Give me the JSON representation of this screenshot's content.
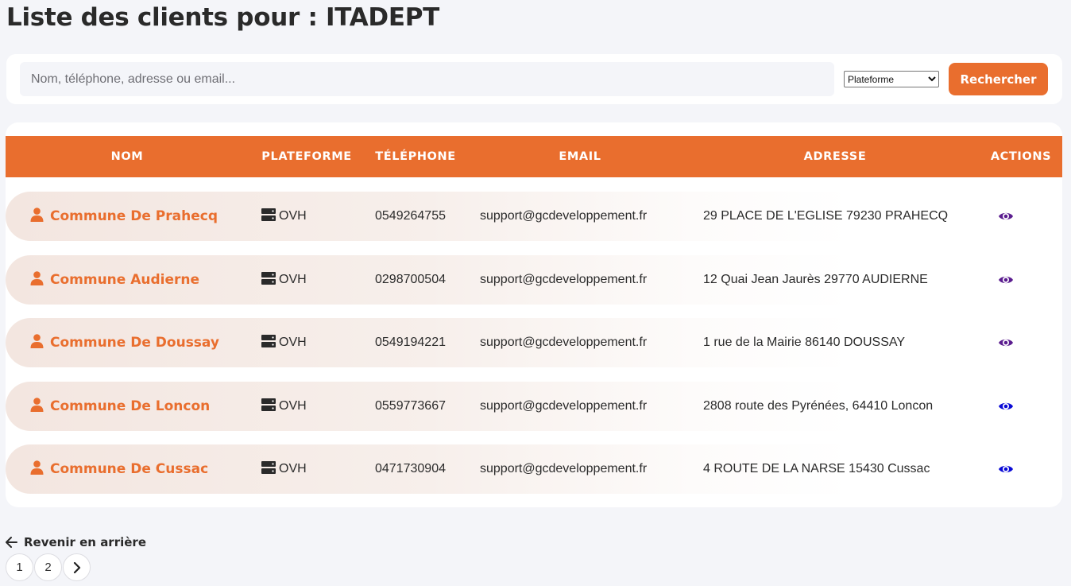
{
  "page": {
    "title": "Liste des clients pour : ITADEPT"
  },
  "search": {
    "placeholder": "Nom, téléphone, adresse ou email...",
    "value": "",
    "platform_selected": "Plateforme",
    "button_label": "Rechercher"
  },
  "table": {
    "headers": {
      "nom": "NOM",
      "plateforme": "PLATEFORME",
      "telephone": "TÉLÉPHONE",
      "email": "EMAIL",
      "adresse": "ADRESSE",
      "actions": "ACTIONS"
    },
    "rows": [
      {
        "name": "Commune De Prahecq",
        "platform": "OVH",
        "phone": "0549264755",
        "email": "support@gcdeveloppement.fr",
        "address": "29 PLACE DE L'EGLISE 79230 PRAHECQ",
        "eye_color": "#5b1d8f"
      },
      {
        "name": "Commune Audierne",
        "platform": "OVH",
        "phone": "0298700504",
        "email": "support@gcdeveloppement.fr",
        "address": "12 Quai Jean Jaurès 29770 AUDIERNE",
        "eye_color": "#5b1d8f"
      },
      {
        "name": "Commune De Doussay",
        "platform": "OVH",
        "phone": "0549194221",
        "email": "support@gcdeveloppement.fr",
        "address": "1 rue de la Mairie 86140 DOUSSAY",
        "eye_color": "#5b1d8f"
      },
      {
        "name": "Commune De Loncon",
        "platform": "OVH",
        "phone": "0559773667",
        "email": "support@gcdeveloppement.fr",
        "address": "2808 route des Pyrénées, 64410 Loncon",
        "eye_color": "#0a0ad6"
      },
      {
        "name": "Commune De Cussac",
        "platform": "OVH",
        "phone": "0471730904",
        "email": "support@gcdeveloppement.fr",
        "address": "4 ROUTE DE LA NARSE 15430 Cussac",
        "eye_color": "#0a0ad6"
      }
    ]
  },
  "footer": {
    "back_label": "Revenir en arrière",
    "pages": [
      "1",
      "2"
    ]
  },
  "colors": {
    "accent": "#e96e2e",
    "visited_eye": "#5b1d8f",
    "link_eye": "#0a0ad6"
  }
}
